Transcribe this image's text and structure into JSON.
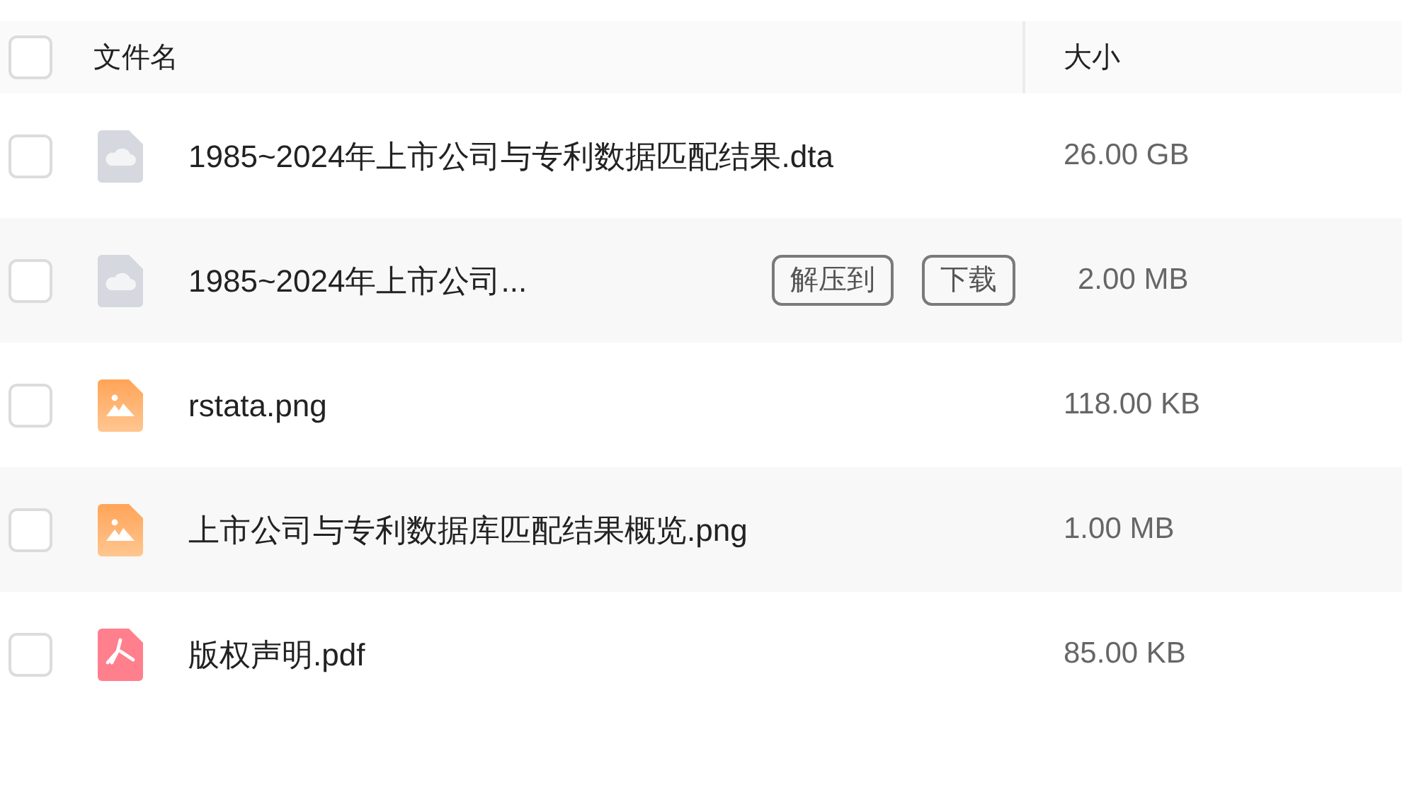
{
  "header": {
    "checked": false,
    "columns": [
      "文件名",
      "大小"
    ]
  },
  "rows": [
    {
      "kind": "cloud",
      "name": "1985~2024年上市公司与专利数据匹配结果.dta",
      "size": "26.00 GB",
      "checked": false
    },
    {
      "kind": "cloud",
      "name": "1985~2024年上市公司...",
      "size": "2.00 MB",
      "checked": false,
      "actions": [
        "解压到",
        "下载"
      ]
    },
    {
      "kind": "image",
      "name": "rstata.png",
      "size": "118.00 KB",
      "checked": false
    },
    {
      "kind": "image",
      "name": "上市公司与专利数据库匹配结果概览.png",
      "size": "1.00 MB",
      "checked": false
    },
    {
      "kind": "pdf",
      "name": "版权声明.pdf",
      "size": "85.00 KB",
      "checked": false
    }
  ]
}
